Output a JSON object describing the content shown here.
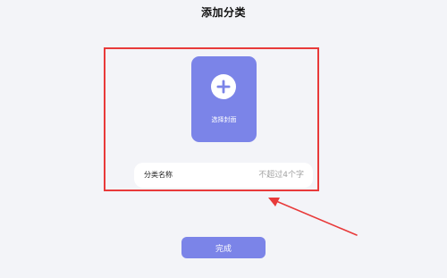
{
  "header": {
    "title": "添加分类"
  },
  "cover": {
    "label": "选择封面",
    "icon": "plus-icon"
  },
  "category_name": {
    "label": "分类名称",
    "placeholder": "不超过4个字",
    "value": ""
  },
  "actions": {
    "done_label": "完成"
  },
  "annotation": {
    "highlight_color": "#e83a3a",
    "arrow_color": "#e83a3a"
  },
  "colors": {
    "accent": "#7b84e8",
    "background": "#f3f4f8"
  }
}
